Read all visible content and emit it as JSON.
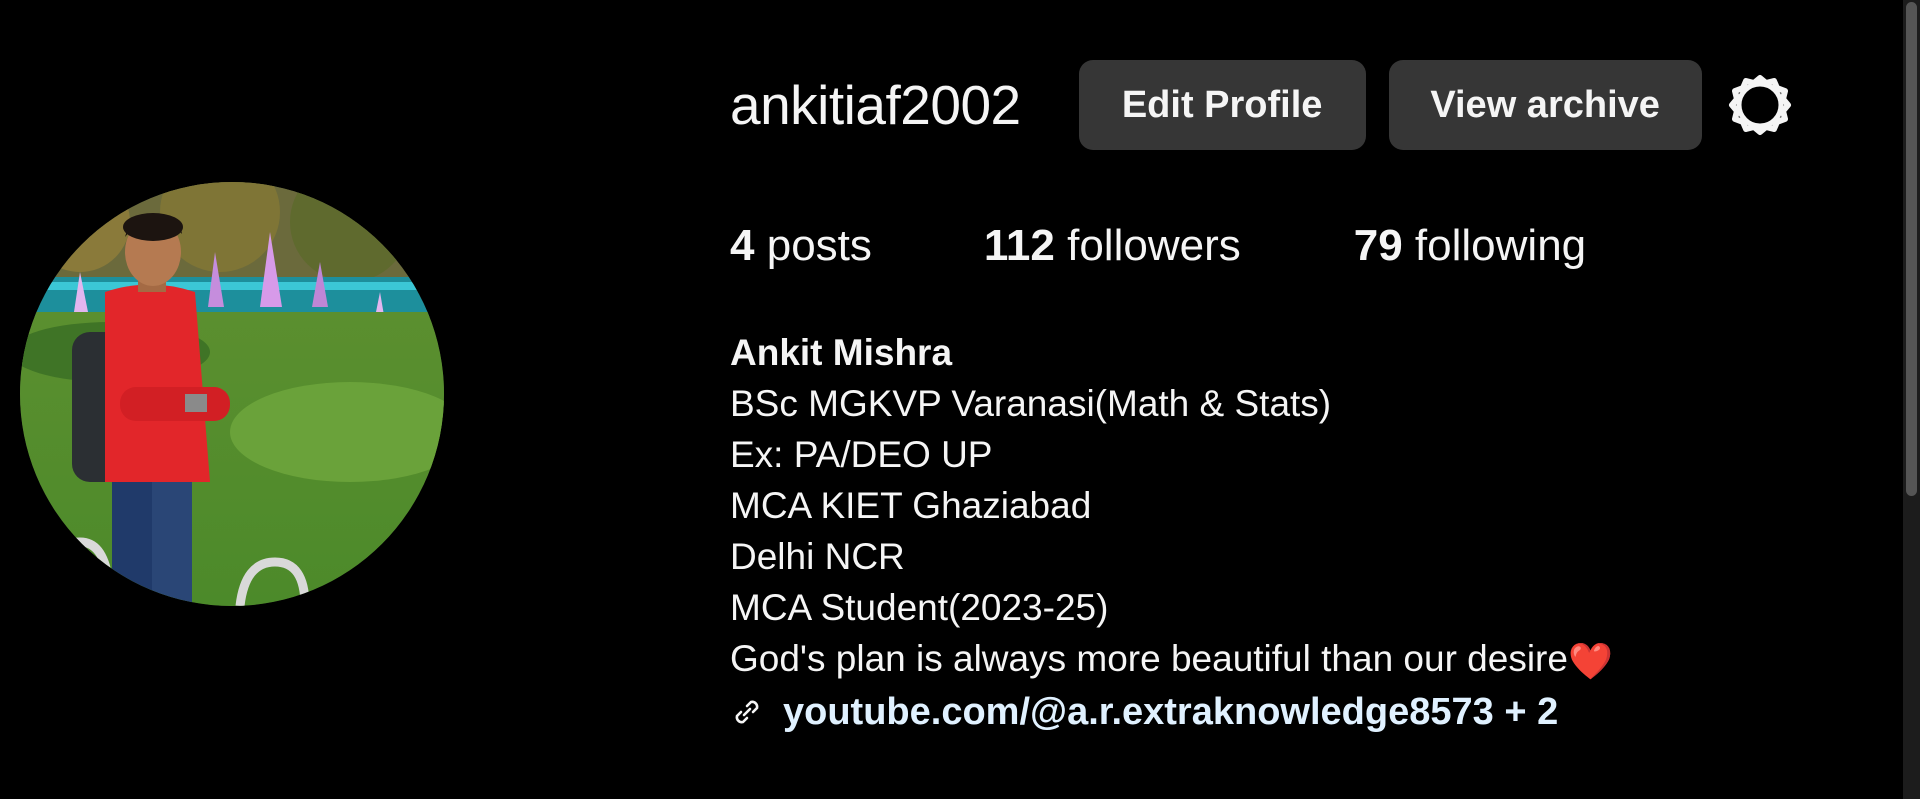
{
  "profile": {
    "username": "ankitiaf2002",
    "edit_profile_label": "Edit Profile",
    "view_archive_label": "View archive",
    "settings_icon": "gear-icon",
    "avatar_icon": "profile-photo"
  },
  "stats": {
    "posts_count": "4",
    "posts_label": "posts",
    "followers_count": "112",
    "followers_label": "followers",
    "following_count": "79",
    "following_label": "following"
  },
  "bio": {
    "name": "Ankit Mishra",
    "lines": [
      "BSc MGKVP Varanasi(Math & Stats)",
      "Ex: PA/DEO UP",
      "MCA KIET Ghaziabad",
      "Delhi NCR",
      "MCA Student(2023-25)",
      "God's plan is always more beautiful than our desire"
    ],
    "heart_emoji": "❤️",
    "link_icon": "link-icon",
    "link_text": "youtube.com/@a.r.extraknowledge8573 + 2"
  },
  "colors": {
    "background": "#000000",
    "button_bg": "#363636",
    "text": "#f5f5f5",
    "link": "#e0f1ff",
    "heart": "#ff3040"
  }
}
